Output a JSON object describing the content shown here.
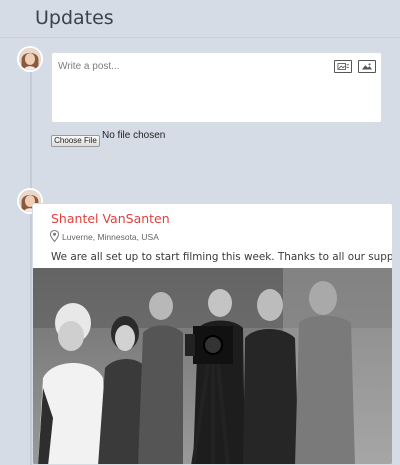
{
  "header": {
    "title": "Updates"
  },
  "composer": {
    "placeholder": "Write a post...",
    "icons": [
      "photo-album-icon",
      "image-add-icon"
    ],
    "file_button_label": "Choose File",
    "file_status": "No file chosen"
  },
  "post": {
    "author": "Shantel VanSanten",
    "location": "Luverne, Minnesota, USA",
    "text": "We are all set up to start filming this week. Thanks to all our supporters!",
    "photo_description_icon": "photo"
  },
  "colors": {
    "background": "#d5dce6",
    "author_name": "#e2403d",
    "card": "#ffffff"
  }
}
